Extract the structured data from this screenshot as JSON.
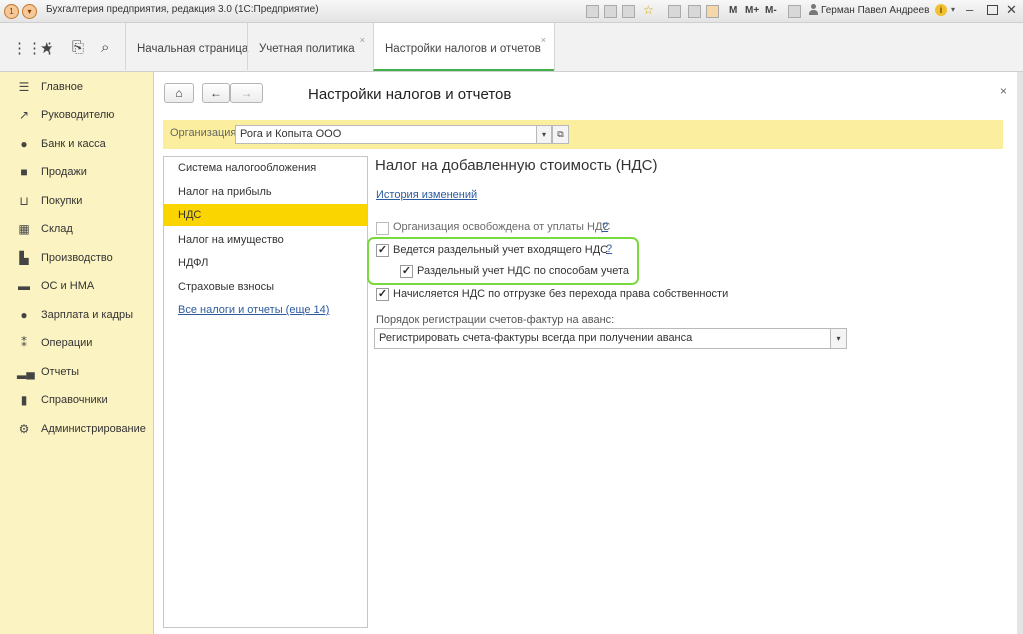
{
  "window": {
    "title": "Бухгалтерия предприятия, редакция 3.0  (1С:Предприятие)",
    "memory_buttons": [
      "M",
      "M+",
      "M-"
    ],
    "user": "Герман Павел Андреевич"
  },
  "tabs": [
    {
      "label": "Начальная страница"
    },
    {
      "label": "Учетная политика"
    },
    {
      "label": "Настройки налогов и отчетов"
    }
  ],
  "sidebar": {
    "items": [
      {
        "label": "Главное",
        "icon": "menu-icon"
      },
      {
        "label": "Руководителю",
        "icon": "trend-icon"
      },
      {
        "label": "Банк и касса",
        "icon": "ruble-coin-icon"
      },
      {
        "label": "Продажи",
        "icon": "shopping-bag-icon"
      },
      {
        "label": "Покупки",
        "icon": "cart-icon"
      },
      {
        "label": "Склад",
        "icon": "warehouse-grid-icon"
      },
      {
        "label": "Производство",
        "icon": "factory-icon"
      },
      {
        "label": "ОС и НМА",
        "icon": "truck-icon"
      },
      {
        "label": "Зарплата и кадры",
        "icon": "person-icon"
      },
      {
        "label": "Операции",
        "icon": "operations-icon"
      },
      {
        "label": "Отчеты",
        "icon": "bar-chart-icon"
      },
      {
        "label": "Справочники",
        "icon": "book-icon"
      },
      {
        "label": "Администрирование",
        "icon": "gear-icon"
      }
    ]
  },
  "page": {
    "title": "Настройки налогов и отчетов",
    "org_label": "Организация:",
    "org_value": "Рога и Копыта ООО"
  },
  "tax_list": {
    "items": [
      {
        "label": "Система налогообложения"
      },
      {
        "label": "Налог на прибыль"
      },
      {
        "label": "НДС"
      },
      {
        "label": "Налог на имущество"
      },
      {
        "label": "НДФЛ"
      },
      {
        "label": "Страховые взносы"
      }
    ],
    "all_link": "Все налоги и отчеты (еще 14)"
  },
  "vat": {
    "title": "Налог на добавленную стоимость (НДС)",
    "history_link": "История изменений",
    "help_mark": "?",
    "options": [
      {
        "label": "Организация освобождена от уплаты НДС",
        "checked": false
      },
      {
        "label": "Ведется раздельный учет входящего НДС",
        "checked": true
      },
      {
        "label": "Раздельный учет НДС по способам учета",
        "checked": true
      },
      {
        "label": "Начисляется НДС по отгрузке без перехода права собственности",
        "checked": true
      }
    ],
    "advance_label": "Порядок регистрации счетов-фактур на аванс:",
    "advance_value": "Регистрировать счета-фактуры всегда при получении аванса"
  },
  "colors": {
    "sidebar_bg": "#fbf3c2",
    "org_bar": "#fbef9f",
    "selected_item": "#fbd500",
    "active_tab_underline": "#41b24a",
    "highlight_frame": "#7ad93e",
    "link": "#2c5a9e"
  }
}
